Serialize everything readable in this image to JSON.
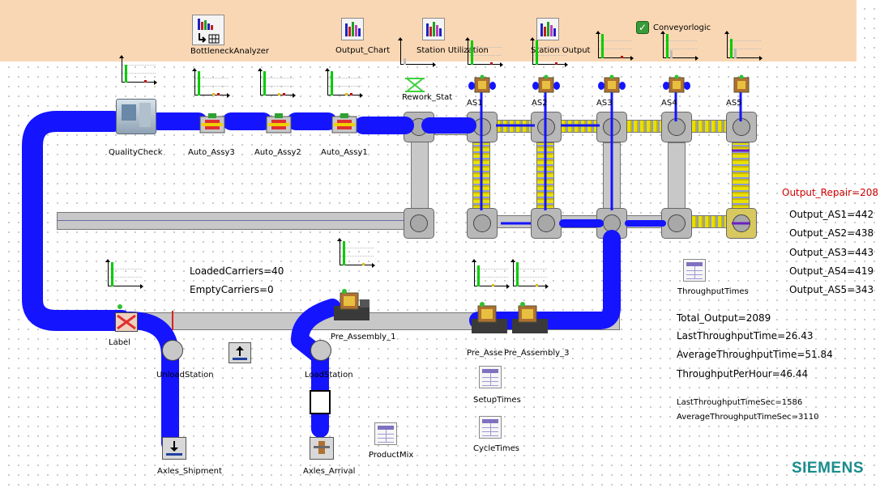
{
  "banner": {
    "tools": [
      {
        "label": "BottleneckAnalyzer"
      },
      {
        "label": "Output_Chart"
      },
      {
        "label": "Station Utilization"
      },
      {
        "label": "Station Output"
      }
    ],
    "checkbox": {
      "label": "Conveyorlogic",
      "checked": true
    }
  },
  "stations": {
    "quality_check": "QualityCheck",
    "auto_assy3": "Auto_Assy3",
    "auto_assy2": "Auto_Assy2",
    "auto_assy1": "Auto_Assy1",
    "rework": "Rework_Stat",
    "as1": "AS1",
    "as2": "AS2",
    "as3": "AS3",
    "as4": "AS4",
    "as5": "AS5",
    "label": "Label",
    "unload": "UnloadStation",
    "load": "LoadStation",
    "pre_assembly_1": "Pre_Assembly_1",
    "pre_assembly_2": "Pre_Assembly_2",
    "pre_assembly_3": "Pre_Assembly_3",
    "axles_shipment": "Axles_Shipment",
    "axles_arrival": "Axles_Arrival"
  },
  "labels": {
    "unload_visible": "Un",
    "unload_tail": "Station",
    "load_tail": "Station",
    "pre_asse_cut": "Pre_Asse"
  },
  "tables": {
    "throughput_times": "ThroughputTimes",
    "setup_times": "SetupTimes",
    "cycle_times": "CycleTimes",
    "product_mix": "ProductMix"
  },
  "carriers": {
    "loaded": "LoadedCarriers=40",
    "empty": "EmptyCarriers=0"
  },
  "outputs": {
    "repair": "Output_Repair=208",
    "as1": "Output_AS1=442",
    "as2": "Output_AS2=438",
    "as3": "Output_AS3=443",
    "as4": "Output_AS4=419",
    "as5": "Output_AS5=343"
  },
  "stats": {
    "total_output": "Total_Output=2089",
    "last_tpt": "LastThroughputTime=26.43",
    "avg_tpt": "AverageThroughputTime=51.84",
    "tph": "ThroughputPerHour=46.44",
    "last_tpt_sec": "LastThroughputTimeSec=1586",
    "avg_tpt_sec": "AverageThroughputTimeSec=3110"
  },
  "brand": "SIEMENS",
  "colors": {
    "banner": "#fad7b4",
    "flow": "#1414ff",
    "repair_text": "#d00000",
    "brand": "#1a8c8c",
    "bar_green": "#00cc00"
  },
  "icons": {
    "bottleneck": "bottleneck-analyzer-icon",
    "chart": "bar-chart-icon",
    "table": "table-icon",
    "station": "station-icon"
  }
}
